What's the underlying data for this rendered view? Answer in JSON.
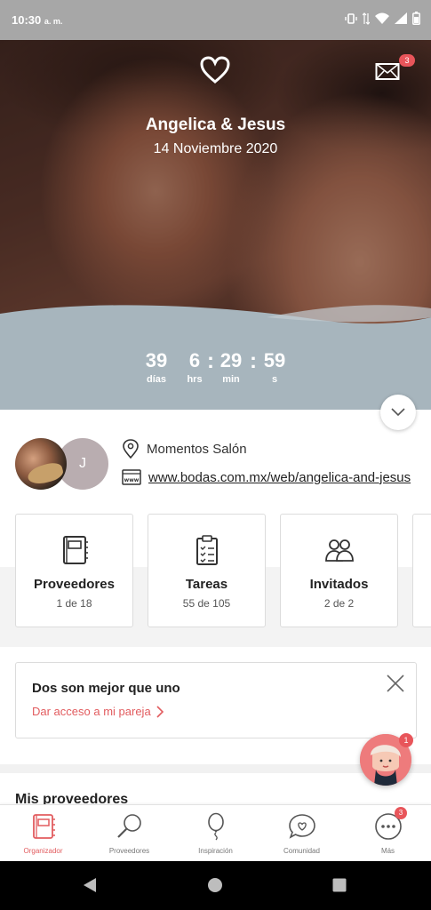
{
  "status_bar": {
    "time": "10:30",
    "ampm": "a. m."
  },
  "header": {
    "couple_name": "Angelica & Jesus",
    "wedding_date": "14 Noviembre 2020",
    "mail_badge": "3"
  },
  "countdown": {
    "days": "39",
    "hours": "6",
    "minutes": "29",
    "seconds": "59",
    "days_label": "días",
    "hours_label": "hrs",
    "minutes_label": "min",
    "seconds_label": "s",
    "separator": ":"
  },
  "profile": {
    "avatar_initial": "J",
    "venue": "Momentos Salón",
    "website": "www.bodas.com.mx/web/angelica-and-jesus"
  },
  "cards": [
    {
      "title": "Proveedores",
      "subtitle": "1 de 18",
      "icon": "notebook-icon"
    },
    {
      "title": "Tareas",
      "subtitle": "55 de 105",
      "icon": "clipboard-checklist-icon"
    },
    {
      "title": "Invitados",
      "subtitle": "2 de 2",
      "icon": "guests-icon"
    }
  ],
  "promo": {
    "title": "Dos son mejor que uno",
    "link": "Dar acceso a mi pareja"
  },
  "sections": {
    "my_vendors": "Mis proveedores"
  },
  "assistant": {
    "badge": "1"
  },
  "bottom_nav": {
    "items": [
      {
        "label": "Organizador",
        "icon": "organizer-icon",
        "active": true
      },
      {
        "label": "Proveedores",
        "icon": "search-icon",
        "active": false
      },
      {
        "label": "Inspiración",
        "icon": "balloon-icon",
        "active": false
      },
      {
        "label": "Comunidad",
        "icon": "chat-heart-icon",
        "active": false
      },
      {
        "label": "Más",
        "icon": "more-icon",
        "active": false,
        "badge": "3"
      }
    ]
  },
  "colors": {
    "accent": "#e25c5f",
    "hero_band": "#a7b5bd",
    "status_bar": "#a7a7a7"
  }
}
